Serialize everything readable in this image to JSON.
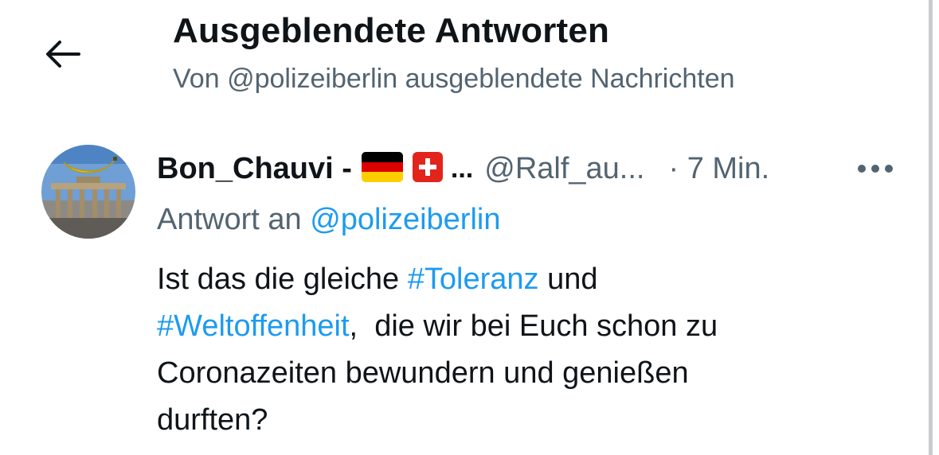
{
  "header": {
    "back_icon": "arrow-left-icon",
    "title": "Ausgeblendete Antworten",
    "subtitle": "Von @polizeiberlin ausgeblendete Nachrichten"
  },
  "post": {
    "avatar_icon": "avatar-brandenburg-gate-banana",
    "display_name": "Bon_Chauvi -",
    "flags": [
      "flag-germany-icon",
      "flag-switzerland-icon"
    ],
    "name_ellipsis": "...",
    "handle": "@Ralf_au...",
    "time": "· 7 Min.",
    "more_icon": "more-options-icon",
    "reply_prefix": "Antwort an",
    "reply_to": "@polizeiberlin",
    "text_parts": [
      "Ist das die gleiche ",
      "#Toleranz",
      " und",
      "#Weltoffenheit",
      ",  die wir bei Euch schon zu",
      "Coronazeiten bewundern und genießen",
      "durften?"
    ]
  },
  "colors": {
    "text_primary": "#0f1419",
    "text_secondary": "#536471",
    "link": "#1d9bf0",
    "background": "#ffffff"
  }
}
